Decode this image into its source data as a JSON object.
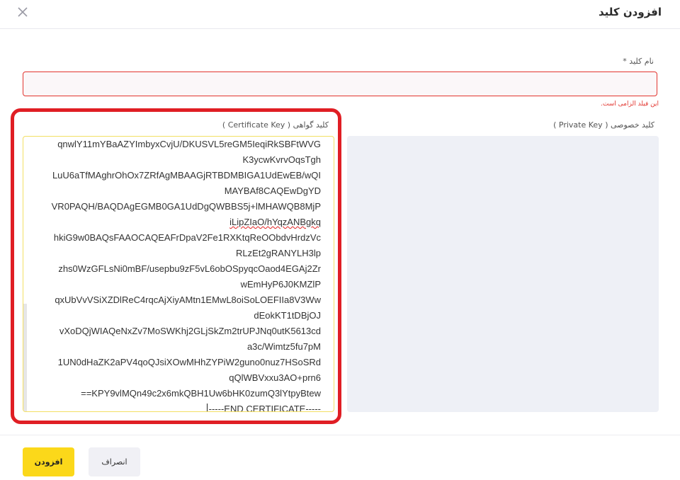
{
  "dialog": {
    "title": "افزودن کلید",
    "close_icon": "close-icon"
  },
  "form": {
    "key_name": {
      "label": "نام کلید *",
      "value": "",
      "error": "این فیلد الزامی است."
    },
    "certificate_key": {
      "label": "کلید گواهی ( Certificate Key )",
      "lines": [
        "qnwlY11mYBaAZYImbyxCvjU/DKUSVL5reGM5IeqiRkSBFtWVG",
        "K3ycwKvrvOqsTgh",
        "LuU6aTfMAghrOhOx7ZRfAgMBAAGjRTBDMBIGA1UdEwEB/wQI",
        "MAYBAf8CAQEwDgYD",
        "VR0PAQH/BAQDAgEGMB0GA1UdDgQWBBS5j+lMHAWQB8MjP",
        "iLipZIaO/hYqzANBgkq",
        "hkiG9w0BAQsFAAOCAQEAFrDpaV2Fe1RXKtqReOObdvHrdzVc",
        "RLzEt2gRANYLH3lp",
        "zhs0WzGFLsNi0mBF/usepbu9zF5vL6obOSpyqcOaod4EGAj2Zr",
        "wEmHyP6J0KMZlP",
        "qxUbVvVSiXZDlReC4rqcAjXiyAMtn1EMwL8oiSoLOEFIIa8V3Ww",
        "dEokKT1tDBjOJ",
        "vXoDQjWIAQeNxZv7MoSWKhj2GLjSkZm2trUPJNq0utK5613cd",
        "a3c/Wimtz5fu7pM",
        "1UN0dHaZK2aPV4qoQJsiXOwMHhZYPiW2guno0nuz7HSoSRd",
        "qQlWBVxxu3AO+prn6",
        "==KPY9vlMQn49c2x6mkQBH1Uw6bHK0zumQ3lYtpyBtew",
        "-----END CERTIFICATE-----"
      ]
    },
    "private_key": {
      "label": "کلید خصوصی ( Private Key )",
      "value": ""
    }
  },
  "footer": {
    "add_label": "افزودن",
    "cancel_label": "انصراف"
  },
  "colors": {
    "accent": "#fbd81a",
    "error": "#e2352f",
    "highlight": "#e01e24",
    "cert_border": "#f3df63",
    "panel_bg": "#eef0f6"
  }
}
